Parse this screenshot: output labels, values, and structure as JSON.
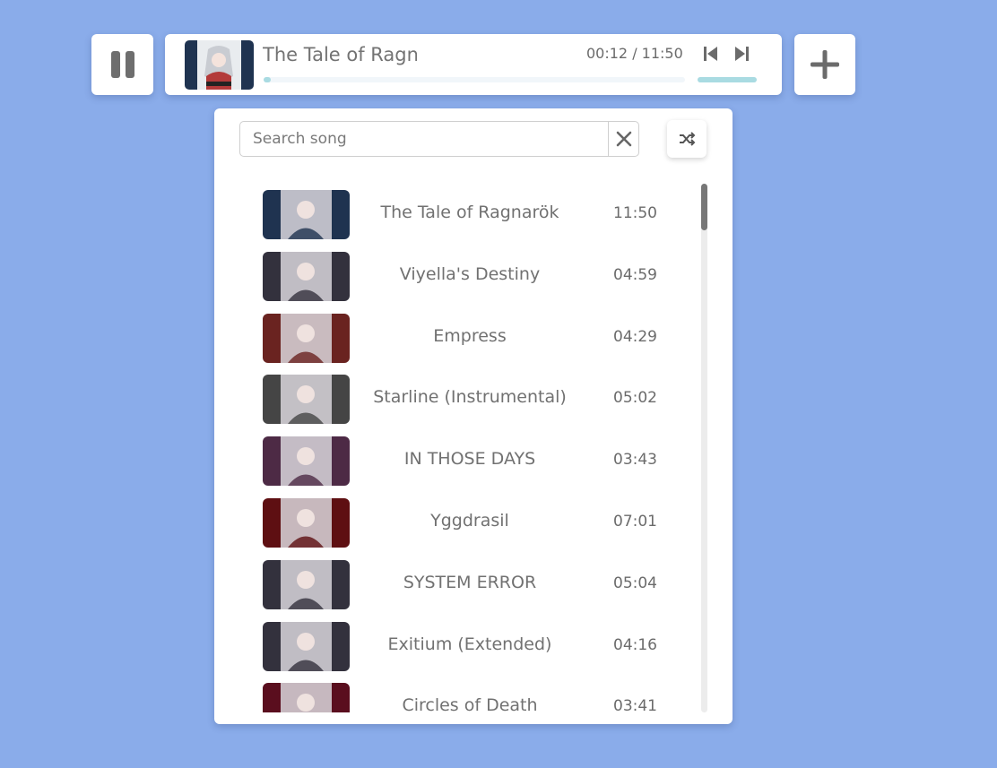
{
  "player": {
    "pause_icon": "pause-icon",
    "now_playing_title": "The Tale of Ragnarök",
    "time_display": "00:12 / 11:50",
    "progress_fraction": 0.017,
    "volume_fraction": 1.0,
    "prev_icon": "skip-previous-icon",
    "next_icon": "skip-next-icon",
    "add_icon": "plus-icon",
    "accent_color": "#a9dbe2"
  },
  "playlist": {
    "search_placeholder": "Search song",
    "clear_icon": "close-icon",
    "shuffle_icon": "shuffle-icon",
    "songs": [
      {
        "title": "The Tale of Ragnarök",
        "duration": "11:50",
        "tint": "#1f3350"
      },
      {
        "title": "Viyella's Destiny",
        "duration": "04:59",
        "tint": "#33313d"
      },
      {
        "title": "Empress",
        "duration": "04:29",
        "tint": "#6a2320"
      },
      {
        "title": "Starline (Instrumental)",
        "duration": "05:02",
        "tint": "#454545"
      },
      {
        "title": "IN THOSE DAYS",
        "duration": "03:43",
        "tint": "#4d2a45"
      },
      {
        "title": "Yggdrasil",
        "duration": "07:01",
        "tint": "#5e0f12"
      },
      {
        "title": "SYSTEM ERROR",
        "duration": "05:04",
        "tint": "#33313d"
      },
      {
        "title": "Exitium (Extended)",
        "duration": "04:16",
        "tint": "#33313d"
      },
      {
        "title": "Circles of Death",
        "duration": "03:41",
        "tint": "#5a0e1e"
      }
    ]
  },
  "colors": {
    "background": "#8aacea",
    "card": "#ffffff",
    "text": "#737373"
  }
}
